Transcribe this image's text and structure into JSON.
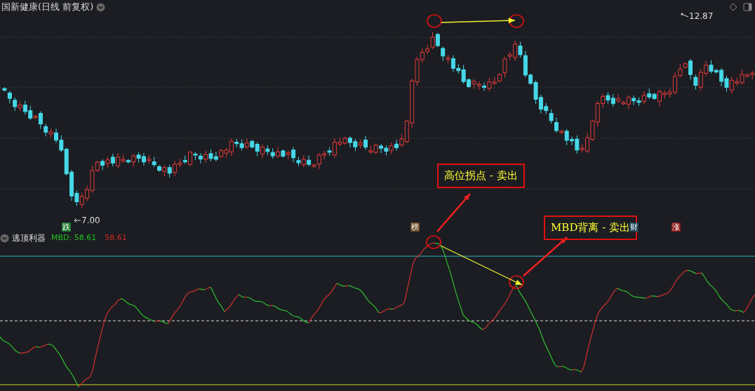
{
  "title": "国新健康(日线 前复权)",
  "price_chart": {
    "high_label": "12.87",
    "low_label": "7.00"
  },
  "signal_tags": [
    {
      "label": "跌",
      "color": "#1f7a2c"
    },
    {
      "label": "榜",
      "color": "#6b4a2a"
    },
    {
      "label": "财",
      "color": "#1c4656"
    },
    {
      "label": "涨",
      "color": "#8e1b1b"
    }
  ],
  "indicator": {
    "name": "逃顶利器",
    "mbd_reading": "MBD: 58.61",
    "second_reading": "58.61"
  },
  "annotations": [
    {
      "text": "高位拐点 - 卖出"
    },
    {
      "text": "MBD背离 - 卖出"
    }
  ]
}
